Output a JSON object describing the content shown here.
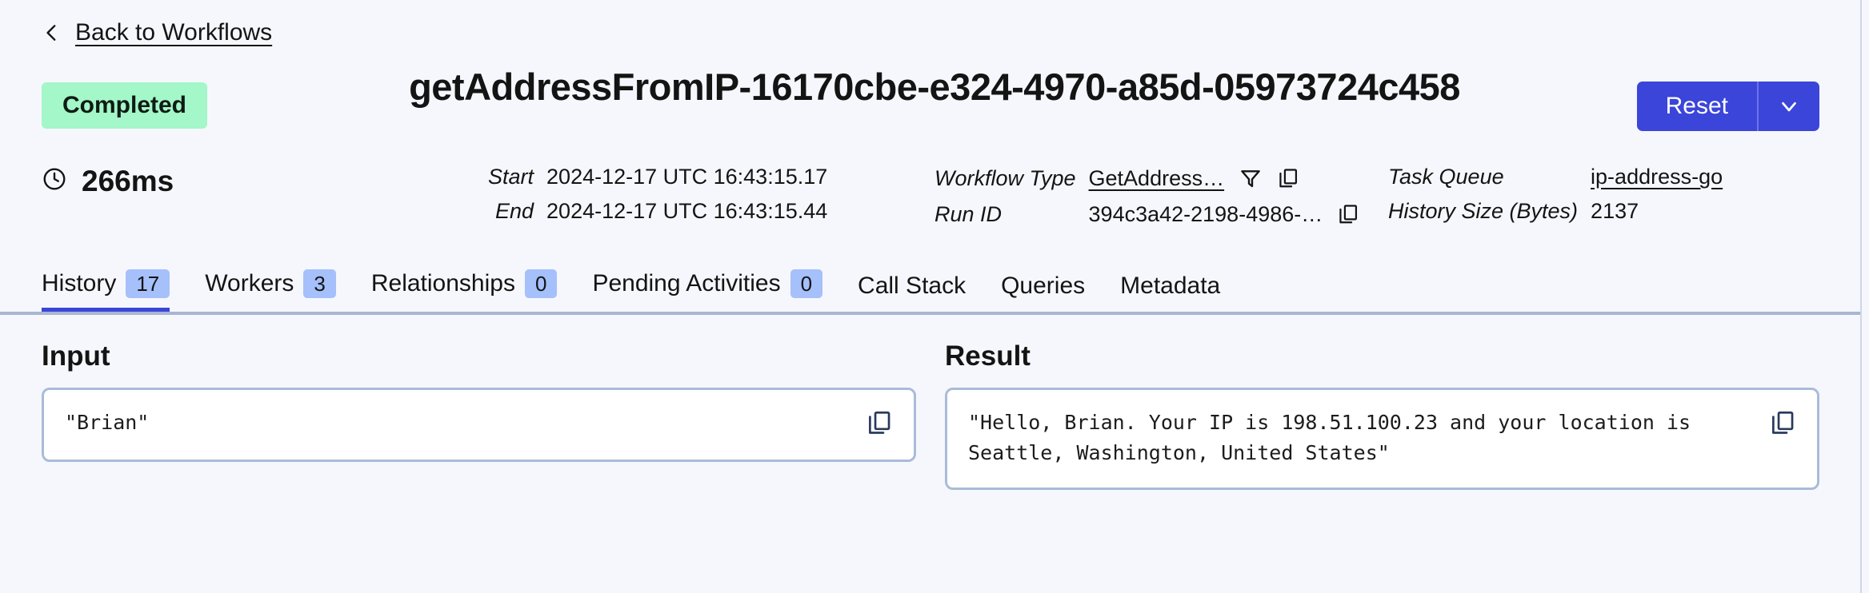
{
  "back": {
    "label": "Back to Workflows",
    "icon": "chevron-left-icon"
  },
  "header": {
    "status": "Completed",
    "title": "getAddressFromIP-16170cbe-e324-4970-a85d-05973724c458",
    "reset_label": "Reset",
    "reset_caret_icon": "chevron-down-icon",
    "accent_color": "#3b45d9",
    "status_bg": "#a3f7c8"
  },
  "meta": {
    "duration": "266ms",
    "duration_icon": "clock-icon",
    "start_label": "Start",
    "start_value": "2024-12-17 UTC 16:43:15.17",
    "end_label": "End",
    "end_value": "2024-12-17 UTC 16:43:15.44",
    "workflow_type_label": "Workflow Type",
    "workflow_type_value": "GetAddress…",
    "workflow_type_filter_icon": "filter-icon",
    "workflow_type_copy_icon": "copy-icon",
    "run_id_label": "Run ID",
    "run_id_value": "394c3a42-2198-4986-…",
    "run_id_copy_icon": "copy-icon",
    "task_queue_label": "Task Queue",
    "task_queue_value": "ip-address-go",
    "history_size_label": "History Size (Bytes)",
    "history_size_value": "2137"
  },
  "tabs": [
    {
      "label": "History",
      "badge": "17",
      "active": true
    },
    {
      "label": "Workers",
      "badge": "3",
      "active": false
    },
    {
      "label": "Relationships",
      "badge": "0",
      "active": false
    },
    {
      "label": "Pending Activities",
      "badge": "0",
      "active": false
    },
    {
      "label": "Call Stack",
      "badge": null,
      "active": false
    },
    {
      "label": "Queries",
      "badge": null,
      "active": false
    },
    {
      "label": "Metadata",
      "badge": null,
      "active": false
    }
  ],
  "panels": {
    "input": {
      "title": "Input",
      "value": "\"Brian\"",
      "copy_icon": "copy-icon"
    },
    "result": {
      "title": "Result",
      "value": "\"Hello, Brian. Your IP is 198.51.100.23 and your location is\nSeattle, Washington, United States\"",
      "copy_icon": "copy-icon"
    }
  }
}
